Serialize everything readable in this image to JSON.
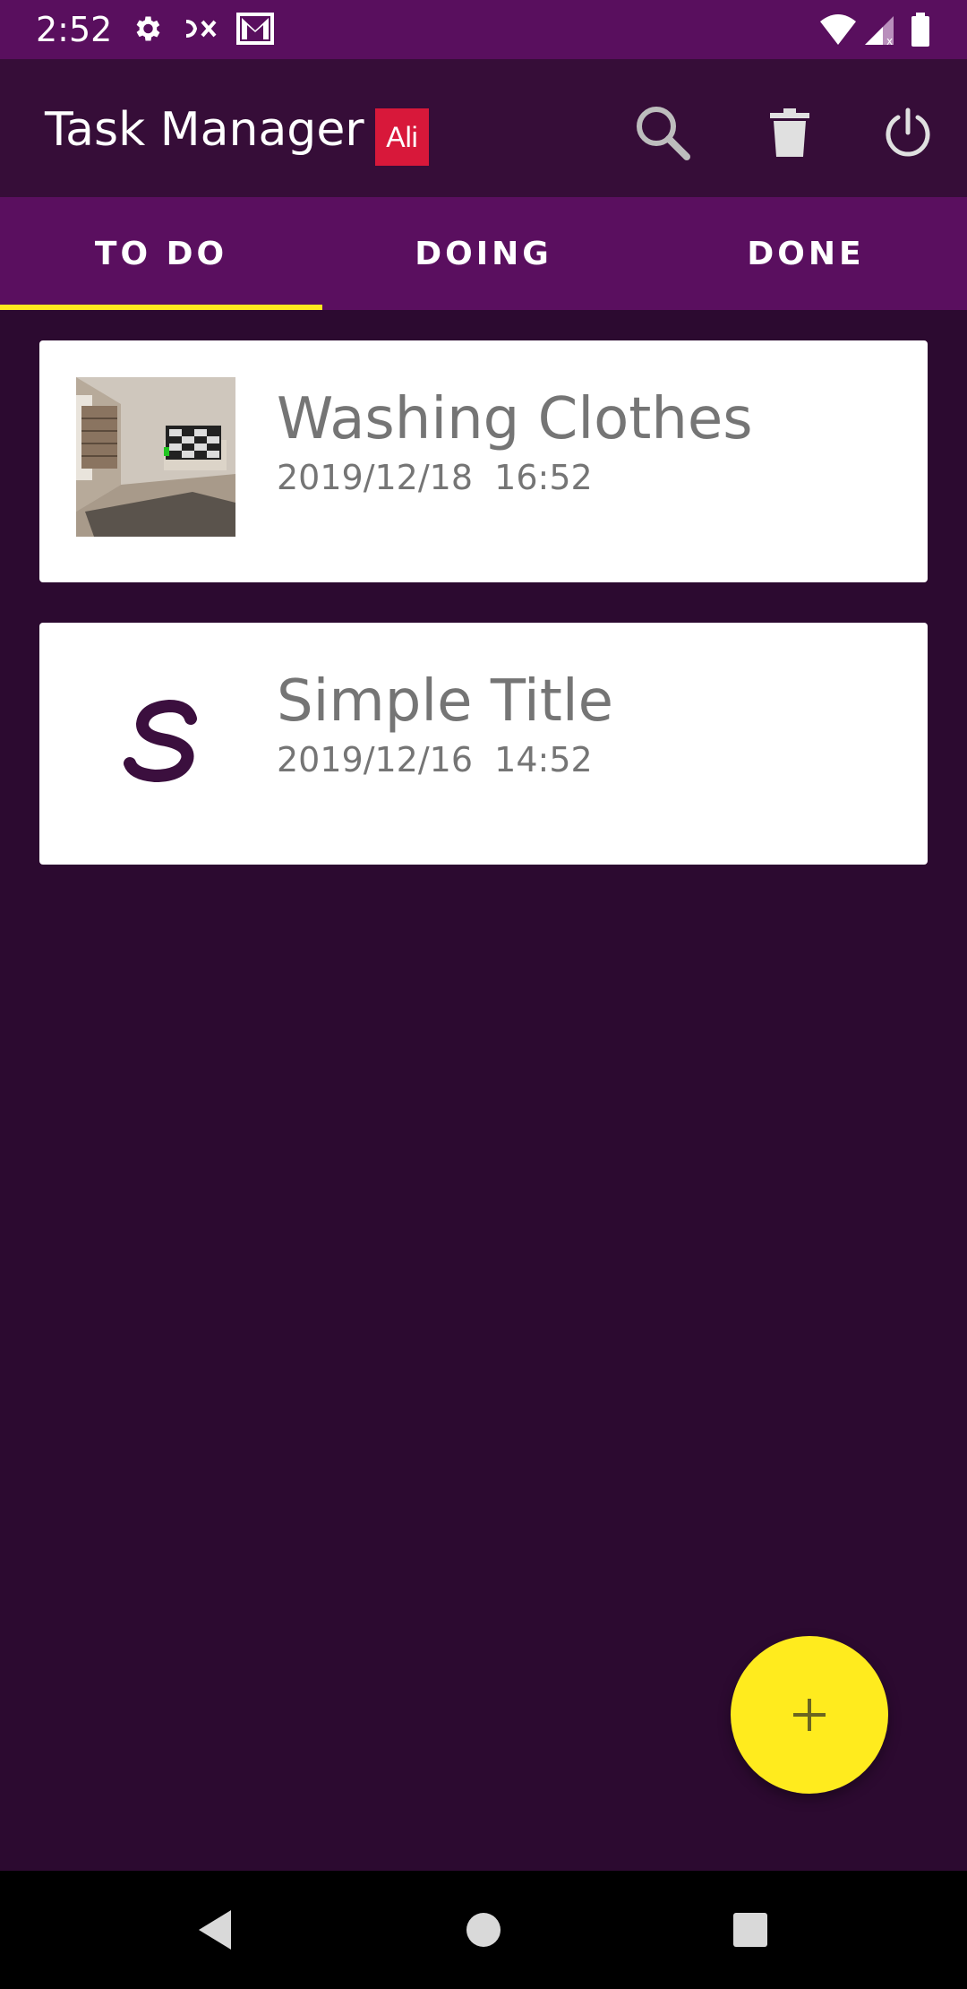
{
  "status_bar": {
    "time": "2:52",
    "icons": [
      "settings-gear-icon",
      "app-notification-icon",
      "gmail-icon",
      "wifi-icon",
      "cellular-signal-icon",
      "battery-icon"
    ]
  },
  "app_bar": {
    "title": "Task Manager",
    "user_badge": "Ali",
    "actions": [
      "search-icon",
      "trash-icon",
      "power-icon"
    ]
  },
  "tabs": [
    {
      "label": "TO DO",
      "selected": true
    },
    {
      "label": "DOING",
      "selected": false
    },
    {
      "label": "DONE",
      "selected": false
    }
  ],
  "tasks": [
    {
      "title": "Washing Clothes",
      "date": "2019/12/18  16:52",
      "thumbnail": "room-photo"
    },
    {
      "title": "Simple Title",
      "date": "2019/12/16  14:52",
      "thumbnail": "letter-s-image"
    }
  ],
  "fab": {
    "icon": "plus-icon"
  },
  "nav_bar": {
    "buttons": [
      "back-icon",
      "home-icon",
      "recents-icon"
    ]
  },
  "colors": {
    "status_bar": "#590f5e",
    "app_bar": "#360d38",
    "tab_bar": "#5a0f5f",
    "background": "#2c0a30",
    "tab_indicator": "#ffe81e",
    "fab": "#ffeb1e",
    "badge": "#d8183a"
  }
}
